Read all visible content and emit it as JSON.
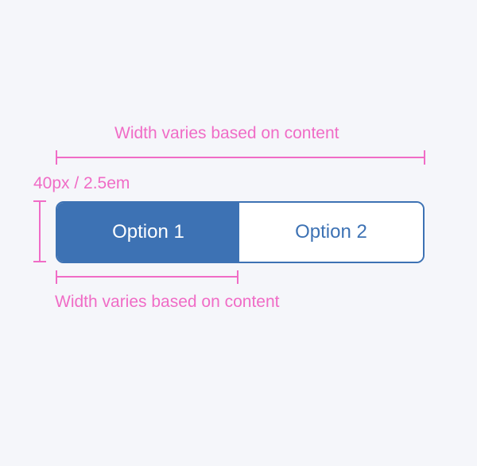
{
  "annotations": {
    "top_width_label": "Width varies based on content",
    "height_label": "40px / 2.5em",
    "bottom_width_label": "Width varies based on content",
    "color": "#f06cc6"
  },
  "segmented_control": {
    "options": [
      {
        "label": "Option 1",
        "selected": true
      },
      {
        "label": "Option 2",
        "selected": false
      }
    ],
    "accent_color": "#3d72b4",
    "background_color": "#ffffff"
  },
  "page": {
    "background_color": "#f5f6fa"
  }
}
